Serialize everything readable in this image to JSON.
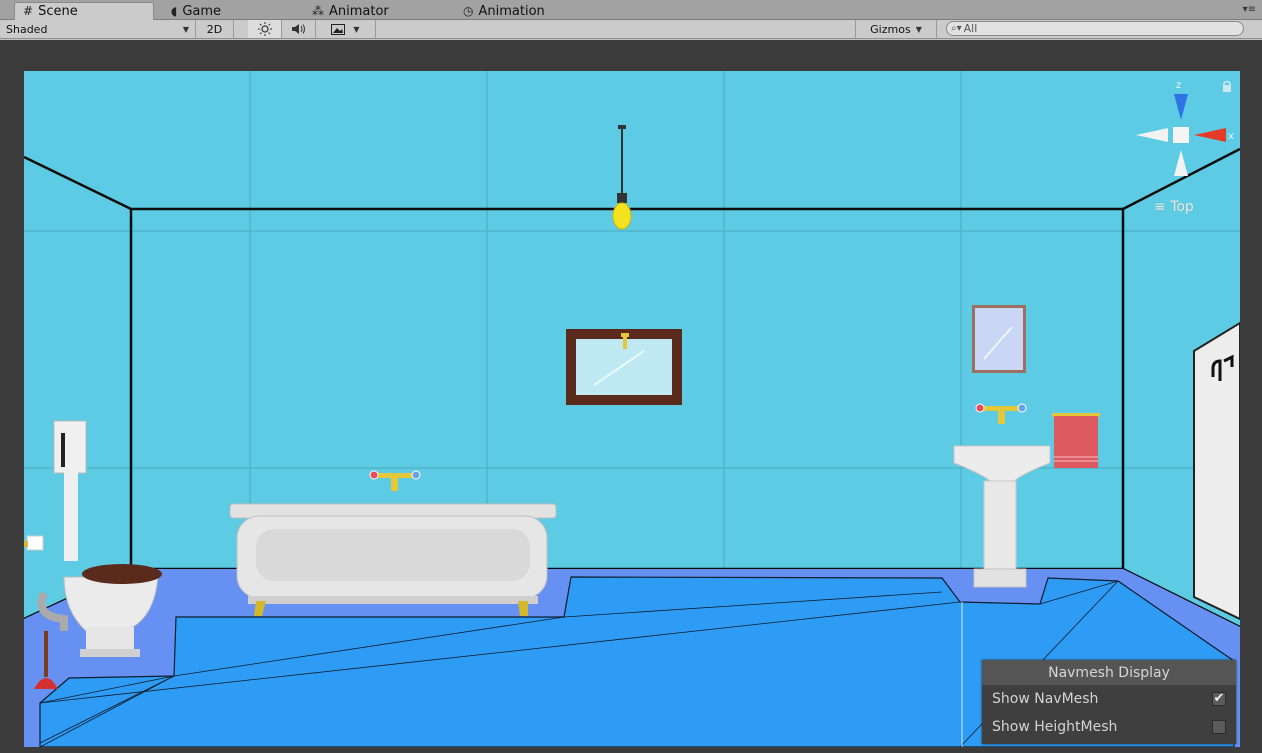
{
  "tabs": [
    {
      "label": "Scene",
      "icon": "grid-icon",
      "glyph": "#",
      "active": true
    },
    {
      "label": "Game",
      "icon": "pacman-icon",
      "glyph": "◖",
      "active": false
    },
    {
      "label": "Animator",
      "icon": "animator-nodes-icon",
      "glyph": "⁂",
      "active": false
    },
    {
      "label": "Animation",
      "icon": "clock-icon",
      "glyph": "◷",
      "active": false
    }
  ],
  "toolbar": {
    "shading_mode": "Shaded",
    "toggle_2d": "2D",
    "lighting_icon": "sun-icon",
    "audio_icon": "speaker-icon",
    "effects_icon": "image-icon",
    "gizmos_label": "Gizmos",
    "search_placeholder": "All",
    "search_icon": "search-icon"
  },
  "gizmo": {
    "z_label": "z",
    "x_label": "x",
    "view_label": "Top"
  },
  "navmesh_panel": {
    "title": "Navmesh Display",
    "rows": [
      {
        "label": "Show NavMesh",
        "checked": true
      },
      {
        "label": "Show HeightMesh",
        "checked": false
      }
    ]
  },
  "colors": {
    "wall": "#5ccbe3",
    "floor_fill": "#6690f2",
    "navmesh": "#2e9bf5",
    "outline": "#0f1d2e",
    "accent_gizmo_z": "#2f73e6",
    "accent_gizmo_x": "#e43a2a",
    "towel": "#dd5a60",
    "frame_wood": "#5a2a1c"
  }
}
